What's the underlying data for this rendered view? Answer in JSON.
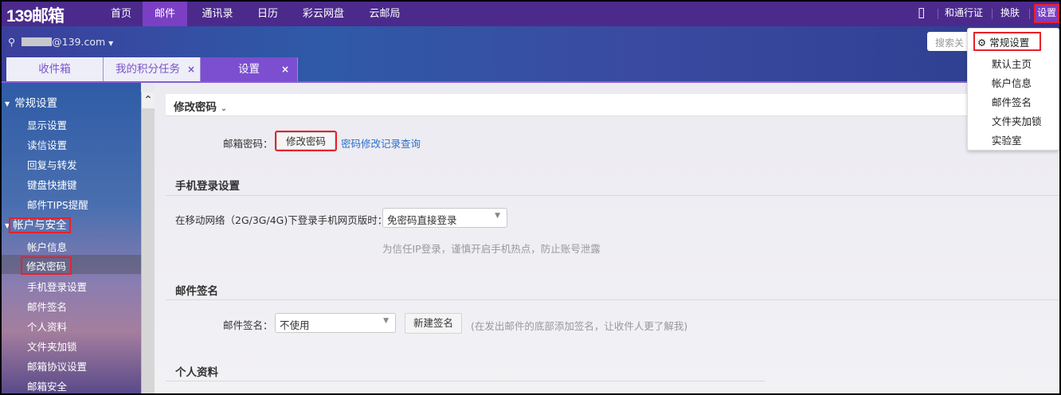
{
  "logo": "139邮箱",
  "topnav": {
    "items": [
      "首页",
      "邮件",
      "通讯录",
      "日历",
      "彩云网盘",
      "云邮局"
    ],
    "active": 1,
    "right": {
      "phone_icon": "mobile-phone-icon",
      "hetong": "和通行证",
      "skin": "换肤",
      "settings": "设置"
    }
  },
  "user": {
    "email": "@139.com"
  },
  "search": {
    "placeholder": "搜索关"
  },
  "tabs": [
    {
      "label": "收件箱"
    },
    {
      "label": "我的积分任务",
      "close": "×"
    },
    {
      "label": "设置",
      "close": "×"
    }
  ],
  "sidebar": {
    "groups": [
      {
        "label": "常规设置",
        "items": [
          "显示设置",
          "读信设置",
          "回复与转发",
          "键盘快捷键",
          "邮件TIPS提醒"
        ]
      },
      {
        "label": "帐户与安全",
        "items": [
          "帐户信息",
          "修改密码",
          "手机登录设置",
          "邮件签名",
          "个人资料",
          "文件夹加锁",
          "邮箱协议设置",
          "邮箱安全"
        ]
      }
    ],
    "selected": "修改密码"
  },
  "content": {
    "header": "修改密码",
    "password": {
      "label": "邮箱密码：",
      "button": "修改密码",
      "link": "密码修改记录查询"
    },
    "mobile": {
      "title": "手机登录设置",
      "label": "在移动网络（2G/3G/4G)下登录手机网页版时：",
      "value": "免密码直接登录",
      "hint": "为信任IP登录，谨慎开启手机热点，防止账号泄露"
    },
    "signature": {
      "title": "邮件签名",
      "label": "邮件签名：",
      "value": "不使用",
      "button": "新建签名",
      "hint": "(在发出邮件的底部添加签名，让收件人更了解我)"
    },
    "profile": {
      "title": "个人资料"
    }
  },
  "settings_menu": [
    "常规设置",
    "默认主页",
    "帐户信息",
    "邮件签名",
    "文件夹加锁",
    "实验室"
  ]
}
